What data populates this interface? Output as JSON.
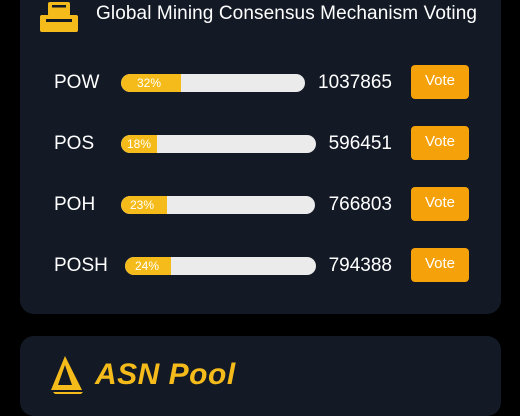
{
  "voting": {
    "title": "Global Mining Consensus Mechanism Voting",
    "vote_label": "Vote",
    "options": [
      {
        "name": "POW",
        "percent": 32,
        "percent_label": "32%",
        "votes": "1037865"
      },
      {
        "name": "POS",
        "percent": 18,
        "percent_label": "18%",
        "votes": "596451"
      },
      {
        "name": "POH",
        "percent": 23,
        "percent_label": "23%",
        "votes": "766803"
      },
      {
        "name": "POSH",
        "percent": 24,
        "percent_label": "24%",
        "votes": "794388"
      }
    ]
  },
  "pool": {
    "brand": "ASN Pool"
  },
  "colors": {
    "accent": "#f5a10a",
    "bar_fill": "#f5bb1a",
    "card_bg": "#131a26",
    "page_bg": "#000000"
  },
  "icons": {
    "header": "ballot-box-icon",
    "logo": "asn-sail-logo-icon"
  }
}
